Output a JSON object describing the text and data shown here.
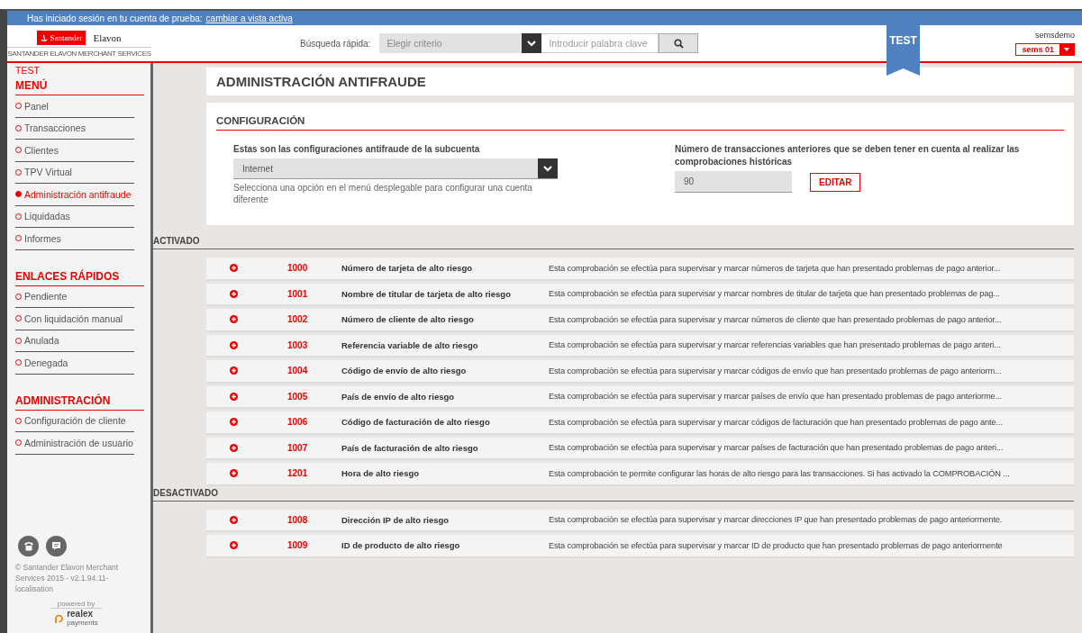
{
  "notice": {
    "text": "Has iniciado sesión en tu cuenta de prueba:",
    "link": "cambiar a vista activa"
  },
  "header": {
    "logo": {
      "bank": "Santander",
      "partner": "Elavon",
      "tagline": "SANTANDER ELAVON MERCHANT SERVICES"
    },
    "search_label": "Búsqueda rápida:",
    "criteria": {
      "placeholder": "Elegir criterio"
    },
    "keyword": {
      "placeholder": "Introducir palabra clave"
    },
    "ribbon": "TEST",
    "user": "semsdemo",
    "account": "sems 01"
  },
  "sidebar": {
    "env": "TEST",
    "sections": [
      {
        "title": "MENÚ",
        "items": [
          {
            "label": "Panel",
            "selected": false
          },
          {
            "label": "Transacciones",
            "selected": false
          },
          {
            "label": "Clientes",
            "selected": false
          },
          {
            "label": "TPV Virtual",
            "selected": false
          },
          {
            "label": "Administración antifraude",
            "selected": true
          },
          {
            "label": "Liquidadas",
            "selected": false
          },
          {
            "label": "Informes",
            "selected": false
          }
        ]
      },
      {
        "title": "ENLACES RÁPIDOS",
        "items": [
          {
            "label": "Pendiente",
            "selected": false
          },
          {
            "label": "Con liquidación manual",
            "selected": false
          },
          {
            "label": "Anulada",
            "selected": false
          },
          {
            "label": "Denegada",
            "selected": false
          }
        ]
      },
      {
        "title": "ADMINISTRACIÓN",
        "items": [
          {
            "label": "Configuración de cliente",
            "selected": false
          },
          {
            "label": "Administración de usuario",
            "selected": false
          }
        ]
      }
    ],
    "footer": {
      "copyright": "© Santander Elavon Merchant Services 2015 - v2.1.94.11-localisation",
      "powered": "powered by",
      "brand": "realex",
      "brand_sub": "payments"
    }
  },
  "page_title": "ADMINISTRACIÓN ANTIFRAUDE",
  "config": {
    "title": "CONFIGURACIÓN",
    "subaccount_label": "Estas son las configuraciones antifraude de la subcuenta",
    "subaccount_value": "Internet",
    "subaccount_help": "Selecciona una opción en el menú desplegable para configurar una cuenta diferente",
    "history_label": "Número de transacciones anteriores que se deben tener en cuenta al realizar las comprobaciones históricas",
    "history_value": "90",
    "edit_button": "EDITAR"
  },
  "groups": [
    {
      "title": "ACTIVADO",
      "rules": [
        {
          "code": "1000",
          "name": "Número de tarjeta de alto riesgo",
          "description": "Esta comprobación se efectúa para supervisar y marcar números de tarjeta que han presentado problemas de pago anterior..."
        },
        {
          "code": "1001",
          "name": "Nombre de titular de tarjeta de alto riesgo",
          "description": "Esta comprobación se efectúa para supervisar y marcar nombres de titular de tarjeta que han presentado problemas de pag..."
        },
        {
          "code": "1002",
          "name": "Número de cliente de alto riesgo",
          "description": "Esta comprobación se efectúa para supervisar y marcar números de cliente que han presentado problemas de pago anterior..."
        },
        {
          "code": "1003",
          "name": "Referencia variable de alto riesgo",
          "description": "Esta comprobación se efectúa para supervisar y marcar referencias variables que han presentado problemas de pago anteri..."
        },
        {
          "code": "1004",
          "name": "Código de envío de alto riesgo",
          "description": "Esta comprobación se efectúa para supervisar y marcar códigos de envío que han presentado problemas de pago anteriorm..."
        },
        {
          "code": "1005",
          "name": "País de envío de alto riesgo",
          "description": "Esta comprobación se efectúa para supervisar y marcar países de envío que han presentado problemas de pago anteriorme..."
        },
        {
          "code": "1006",
          "name": "Código de facturación de alto riesgo",
          "description": "Esta comprobación se efectúa para supervisar y marcar códigos de facturación que han presentado problemas de pago ante..."
        },
        {
          "code": "1007",
          "name": "País de facturación de alto riesgo",
          "description": "Esta comprobación se efectúa para supervisar y marcar países de facturación que han presentado problemas de pago anteri..."
        },
        {
          "code": "1201",
          "name": "Hora de alto riesgo",
          "description": "Esta comprobación te permite configurar las horas de alto riesgo para las transacciones. Si has activado la COMPROBACIÓN ..."
        }
      ]
    },
    {
      "title": "DESACTIVADO",
      "rules": [
        {
          "code": "1008",
          "name": "Dirección IP de alto riesgo",
          "description": "Esta comprobación se efectúa para supervisar y marcar direcciones IP que han presentado problemas de pago anteriormente."
        },
        {
          "code": "1009",
          "name": "ID de producto de alto riesgo",
          "description": "Esta comprobación se efectúa para supervisar y marcar ID de producto que han presentado problemas de pago anteriormente"
        }
      ]
    }
  ]
}
